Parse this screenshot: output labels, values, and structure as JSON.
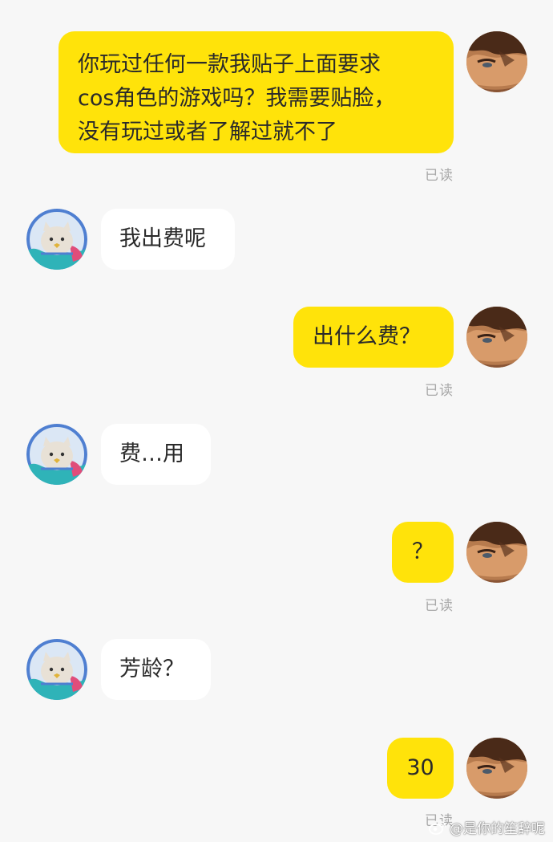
{
  "messages": [
    {
      "side": "out",
      "text": "你玩过任何一款我贴子上面要求\ncos角色的游戏吗？我需要贴脸，\n没有玩过或者了解过就不了",
      "status": "已读"
    },
    {
      "side": "in",
      "text": "我出费呢"
    },
    {
      "side": "out",
      "text": "出什么费？",
      "status": "已读"
    },
    {
      "side": "in",
      "text": "费…用"
    },
    {
      "side": "out",
      "text": "？",
      "status": "已读"
    },
    {
      "side": "in",
      "text": "芳龄？"
    },
    {
      "side": "out",
      "text": "30",
      "status": "已读"
    }
  ],
  "watermark": {
    "text": "@是你的笙辞呢",
    "icon": "weibo-icon"
  },
  "colors": {
    "background": "#f7f7f7",
    "outgoing_bubble": "#ffe30a",
    "incoming_bubble": "#ffffff",
    "read_status": "#a8a8a8"
  },
  "avatars": {
    "self": "anime-character-avatar",
    "other": "cat-astronaut-avatar"
  }
}
